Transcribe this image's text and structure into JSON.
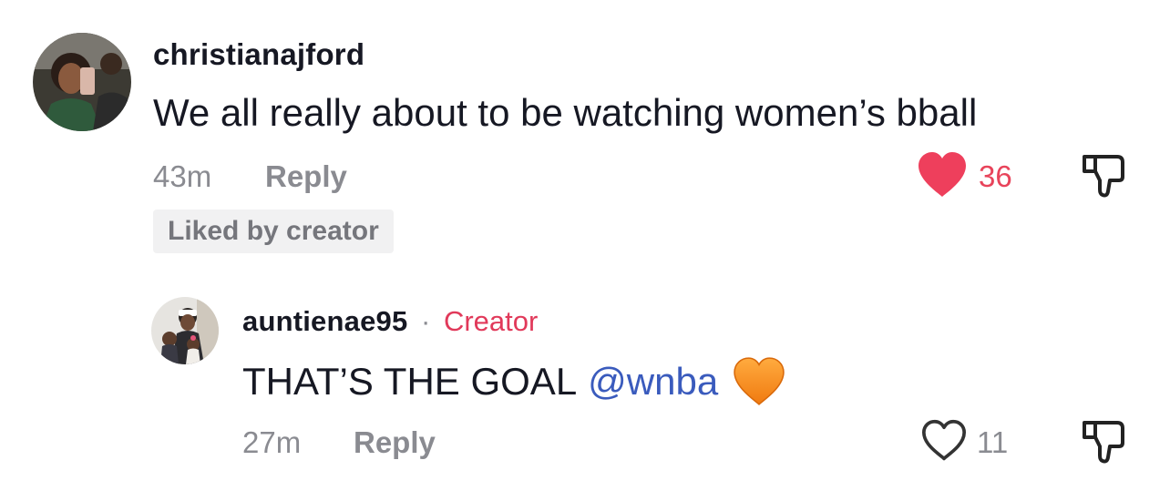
{
  "comments": [
    {
      "username": "christianajford",
      "text": "We all really about to be watching women’s bball",
      "time": "43m",
      "reply_label": "Reply",
      "likes": "36",
      "liked": true,
      "badge": "Liked by creator"
    }
  ],
  "reply": {
    "username": "auntienae95",
    "separator": "·",
    "role": "Creator",
    "text": "THAT’S THE GOAL",
    "mention": "@wnba",
    "time": "27m",
    "reply_label": "Reply",
    "likes": "11",
    "liked": false
  },
  "colors": {
    "heart_liked": "#ee3f5c",
    "creator_tag": "#e1395a",
    "mention": "#3a5bbd",
    "muted": "#8a8b91"
  },
  "icons": [
    "heart-filled-icon",
    "heart-outline-icon",
    "dislike-icon",
    "orange-heart-emoji"
  ]
}
